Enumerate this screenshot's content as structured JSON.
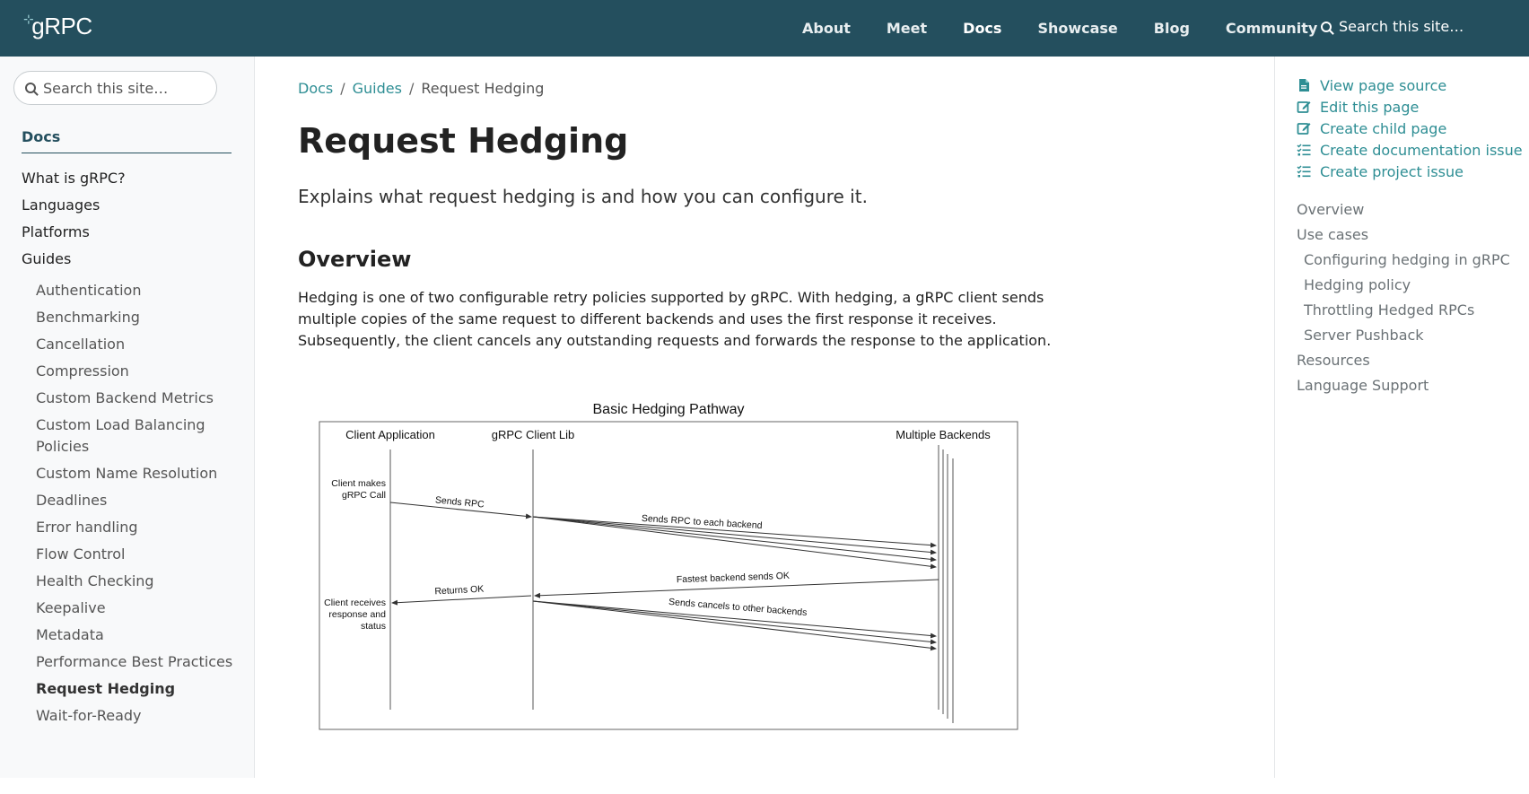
{
  "header": {
    "logo": "gRPC",
    "nav": [
      "About",
      "Meet",
      "Docs",
      "Showcase",
      "Blog",
      "Community"
    ],
    "active_nav": "Docs",
    "search_placeholder": "Search this site…"
  },
  "sidebar": {
    "search_placeholder": "Search this site…",
    "title": "Docs",
    "top_items": [
      "What is gRPC?",
      "Languages",
      "Platforms",
      "Guides"
    ],
    "guides": [
      "Authentication",
      "Benchmarking",
      "Cancellation",
      "Compression",
      "Custom Backend Metrics",
      "Custom Load Balancing Policies",
      "Custom Name Resolution",
      "Deadlines",
      "Error handling",
      "Flow Control",
      "Health Checking",
      "Keepalive",
      "Metadata",
      "Performance Best Practices",
      "Request Hedging",
      "Wait-for-Ready"
    ],
    "active_guide": "Request Hedging"
  },
  "main": {
    "breadcrumb": [
      "Docs",
      "Guides",
      "Request Hedging"
    ],
    "title": "Request Hedging",
    "lead": "Explains what request hedging is and how you can configure it.",
    "section_heading": "Overview",
    "paragraph": "Hedging is one of two configurable retry policies supported by gRPC. With hedging, a gRPC client sends multiple copies of the same request to different backends and uses the first response it receives. Subsequently, the client cancels any outstanding requests and forwards the response to the application.",
    "diagram": {
      "title": "Basic Hedging Pathway",
      "lanes": [
        "Client Application",
        "gRPC Client Lib",
        "Multiple Backends"
      ],
      "client_makes_call": "Client makes gRPC Call",
      "sends_rpc": "Sends RPC",
      "sends_rpc_each": "Sends RPC to each backend",
      "fastest_ok": "Fastest backend sends OK",
      "returns_ok": "Returns OK",
      "client_receives": "Client receives response and status",
      "sends_cancels": "Sends cancels to other backends"
    }
  },
  "right": {
    "actions": [
      {
        "label": "View page source",
        "icon": "file-icon"
      },
      {
        "label": "Edit this page",
        "icon": "edit-icon"
      },
      {
        "label": "Create child page",
        "icon": "edit-icon"
      },
      {
        "label": "Create documentation issue",
        "icon": "tasks-icon"
      },
      {
        "label": "Create project issue",
        "icon": "tasks-icon"
      }
    ],
    "toc": [
      {
        "label": "Overview",
        "sub": false
      },
      {
        "label": "Use cases",
        "sub": false
      },
      {
        "label": "Configuring hedging in gRPC",
        "sub": true
      },
      {
        "label": "Hedging policy",
        "sub": true
      },
      {
        "label": "Throttling Hedged RPCs",
        "sub": true
      },
      {
        "label": "Server Pushback",
        "sub": true
      },
      {
        "label": "Resources",
        "sub": false
      },
      {
        "label": "Language Support",
        "sub": false
      }
    ]
  },
  "colors": {
    "header_bg": "#244f5e",
    "link": "#2e8e94"
  }
}
